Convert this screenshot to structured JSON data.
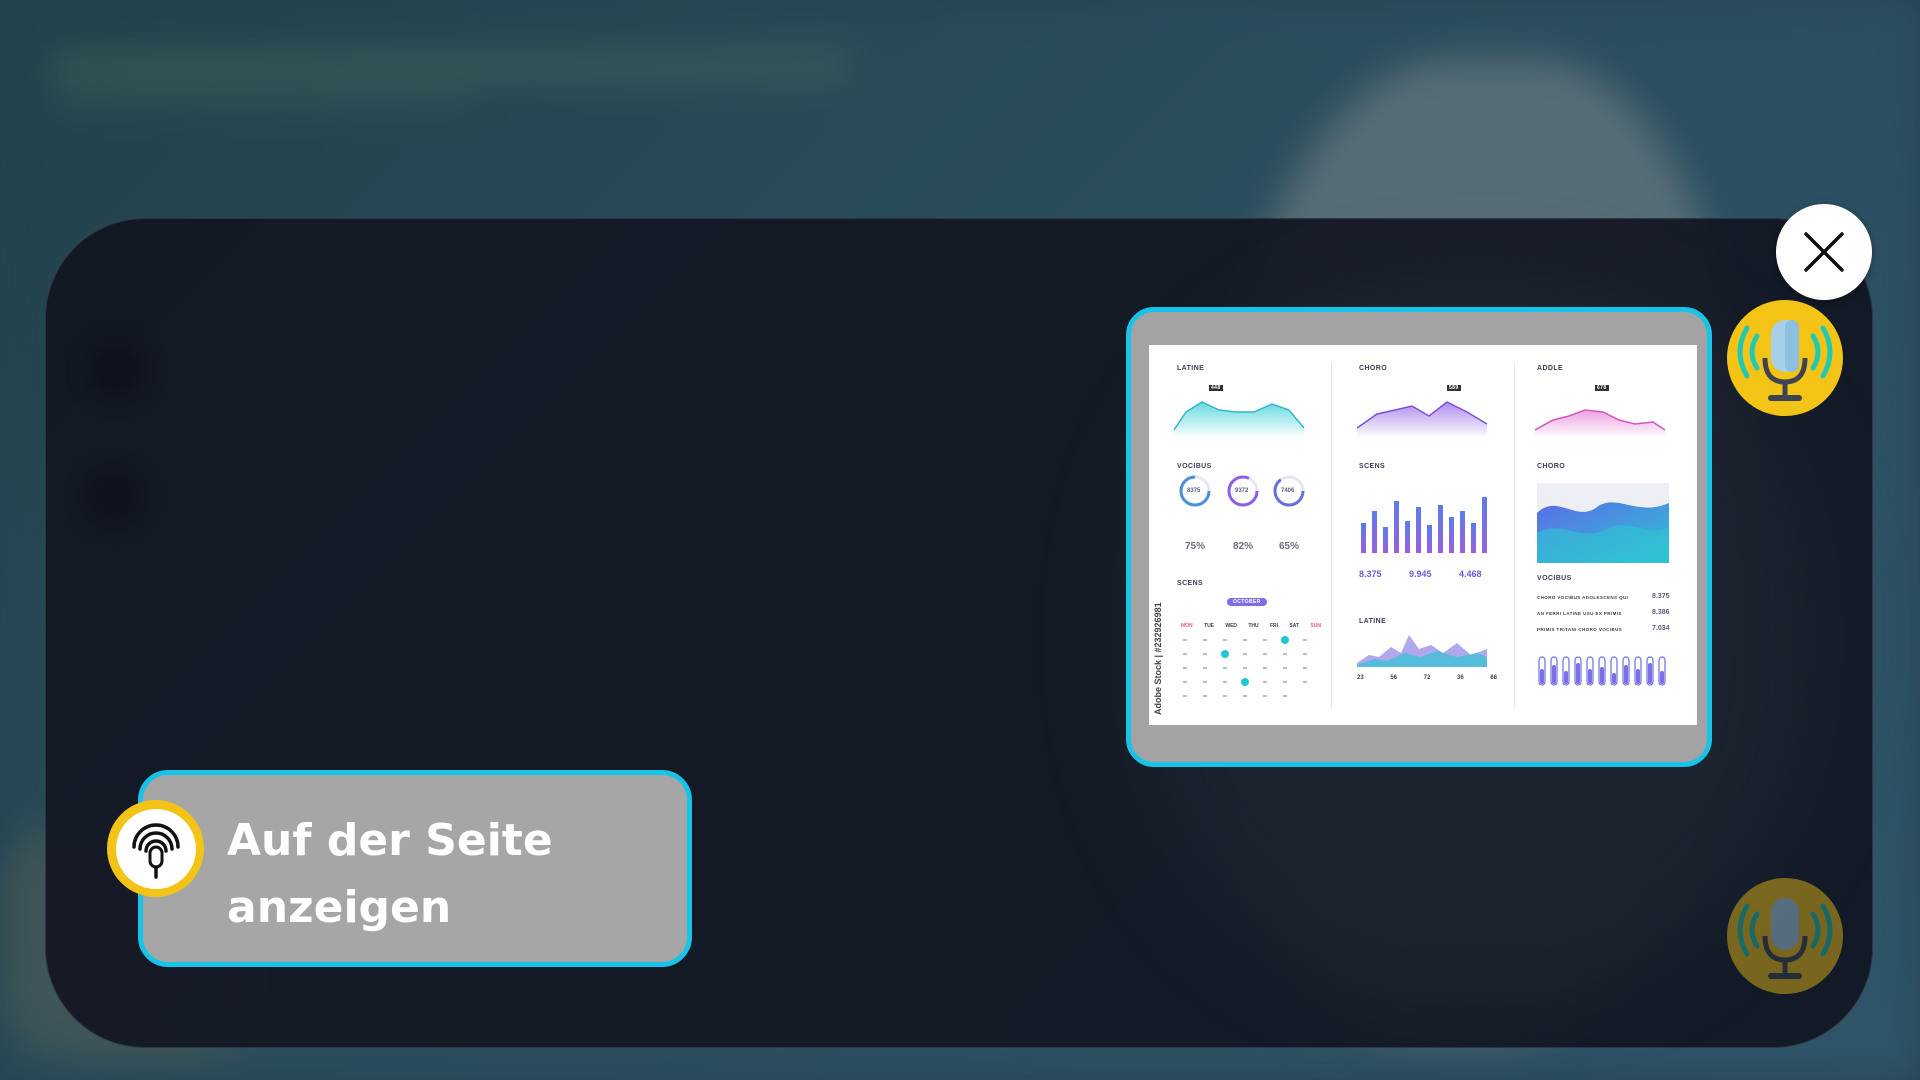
{
  "assistant": {
    "prompt_line1": "Auf der Seite",
    "prompt_line2": "anzeigen",
    "preview": {
      "watermark": "Adobe Stock | #232926981",
      "col1": {
        "latine_label": "LATINE",
        "latine_peak": "448",
        "vocibus_label": "VOCIBUS",
        "rings": [
          "8375",
          "9372",
          "7406"
        ],
        "ring_percents": [
          "75%",
          "82%",
          "65%"
        ],
        "scens_label": "SCENS",
        "calendar_month": "OCTOBER",
        "weekdays": [
          "MON",
          "TUE",
          "WED",
          "THU",
          "FRI",
          "SAT",
          "SUN"
        ]
      },
      "col2": {
        "choro_label": "CHORO",
        "choro_peak": "589",
        "scens_label": "SCENS",
        "stats": [
          "8.375",
          "9.945",
          "4.468"
        ],
        "latine_label": "LATINE",
        "chips": [
          "23",
          "56",
          "72",
          "36",
          "68"
        ]
      },
      "col3": {
        "addle_label": "ADDLE",
        "addle_peak": "678",
        "choro_label": "CHORO",
        "vocibus_label": "VOCIBUS",
        "rows": [
          "CHORO VOCIBUS ADOLESCENS QUI",
          "AN FERRI LATINE USU EX PRIMIS",
          "PRIMIS TRITANI CHORO VOCIBUS"
        ],
        "row_values": [
          "8.375",
          "8.386",
          "7.034"
        ]
      }
    }
  },
  "icons": {
    "close": "close-icon",
    "mic_active": "microphone-icon",
    "mic_dim": "microphone-icon",
    "bubble": "microphone-broadcast-icon"
  },
  "colors": {
    "accent": "#17c3e6",
    "mic_yellow": "#f3c316",
    "overlay": "#111622",
    "bubble": "#a6a6a6"
  }
}
